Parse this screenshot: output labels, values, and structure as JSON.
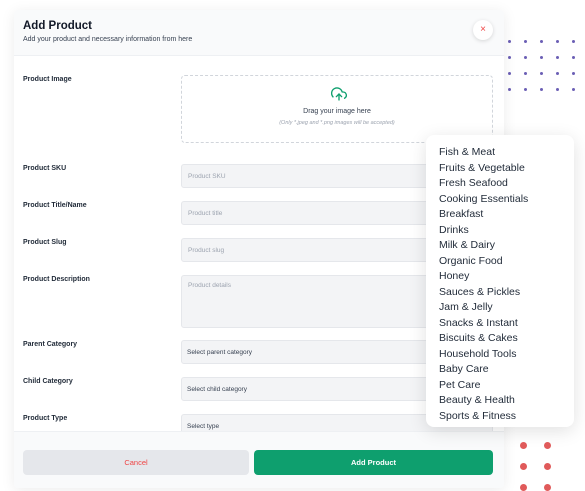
{
  "header": {
    "title": "Add Product",
    "subtitle": "Add your product and necessary information from here",
    "close_icon": "×"
  },
  "form": {
    "image_label": "Product Image",
    "dropzone_title": "Drag your image here",
    "dropzone_hint": "(Only *.jpeg and *.png images will be accepted)",
    "sku_label": "Product SKU",
    "sku_placeholder": "Product SKU",
    "title_label": "Product Title/Name",
    "title_placeholder": "Product title",
    "slug_label": "Product Slug",
    "slug_placeholder": "Product slug",
    "description_label": "Product Description",
    "description_placeholder": "Product details",
    "parent_category_label": "Parent Category",
    "parent_category_value": "Select parent category",
    "child_category_label": "Child Category",
    "child_category_value": "Select child category",
    "type_label": "Product Type",
    "type_value": "Select type"
  },
  "footer": {
    "cancel_label": "Cancel",
    "add_label": "Add Product"
  },
  "category_menu": {
    "items": [
      "Fish & Meat",
      "Fruits & Vegetable",
      "Fresh Seafood",
      "Cooking Essentials",
      "Breakfast",
      "Drinks",
      "Milk & Dairy",
      "Organic Food",
      "Honey",
      "Sauces & Pickles",
      "Jam & Jelly",
      "Snacks & Instant",
      "Biscuits & Cakes",
      "Household Tools",
      "Baby Care",
      "Pet Care",
      "Beauty & Health",
      "Sports & Fitness"
    ]
  },
  "colors": {
    "accent_green": "#0e9f6e",
    "danger_red": "#ef4444",
    "dot_purple": "#6b5fb5",
    "dot_red": "#e05a5a"
  }
}
